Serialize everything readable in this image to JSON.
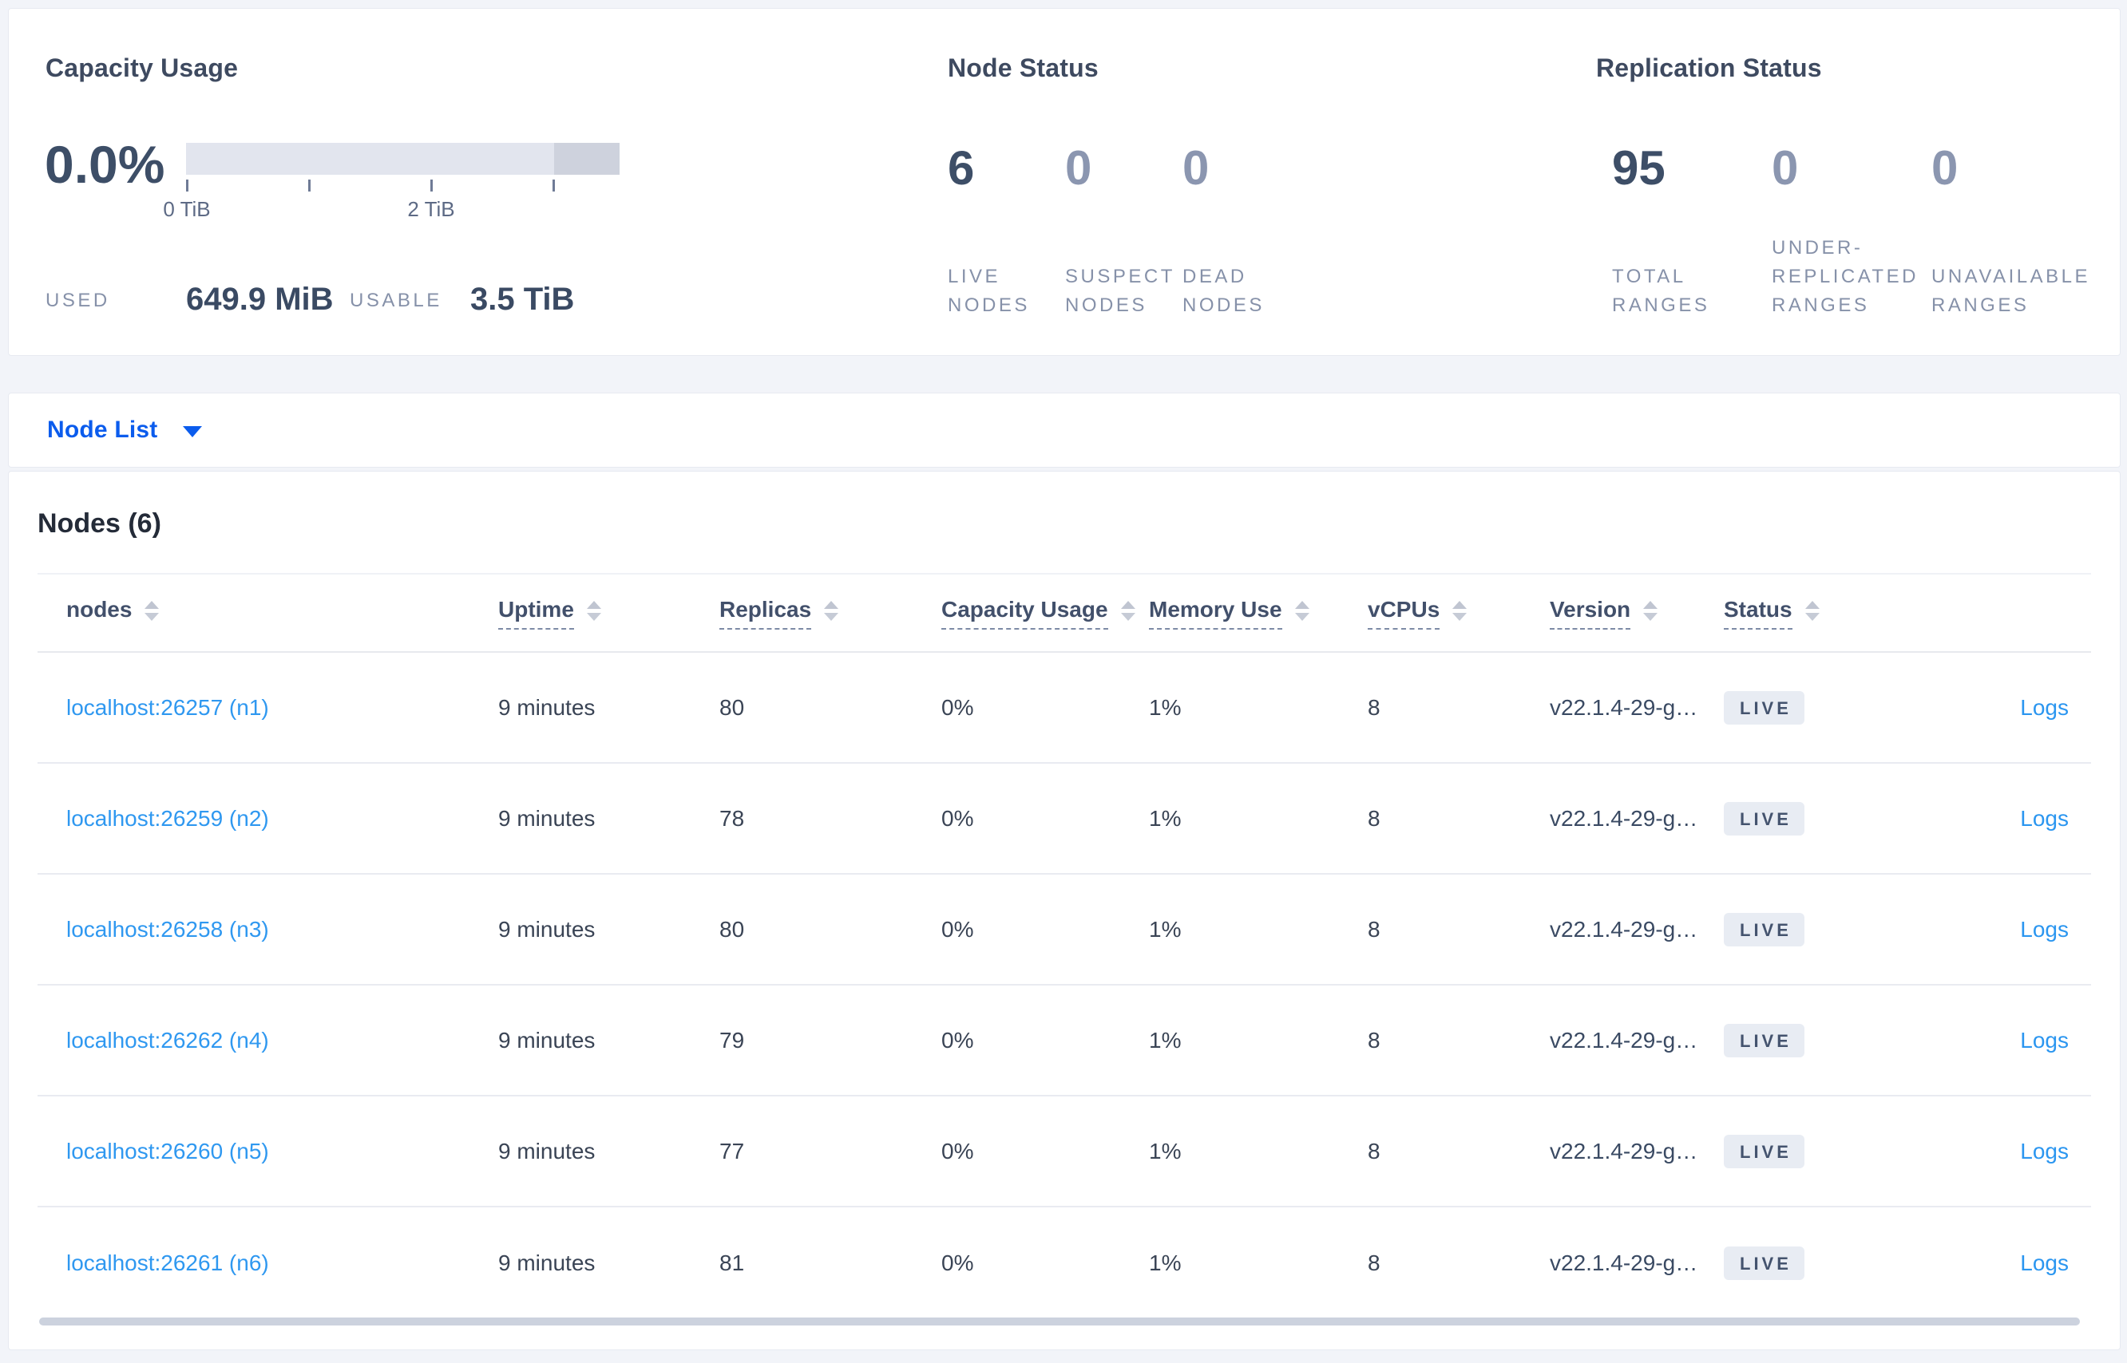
{
  "summary": {
    "capacity": {
      "title": "Capacity Usage",
      "percent": "0.0%",
      "tick_labels": [
        "0 TiB",
        "2 TiB"
      ],
      "used_label": "USED",
      "used_value": "649.9 MiB",
      "usable_label": "USABLE",
      "usable_value": "3.5 TiB",
      "bar_used_percent": 0,
      "bar_reserved_percent": 15.1
    },
    "node_status": {
      "title": "Node Status",
      "stats": [
        {
          "value": "6",
          "label": "LIVE NODES",
          "emphasized": true
        },
        {
          "value": "0",
          "label": "SUSPECT NODES",
          "emphasized": false
        },
        {
          "value": "0",
          "label": "DEAD NODES",
          "emphasized": false
        }
      ]
    },
    "replication_status": {
      "title": "Replication Status",
      "stats": [
        {
          "value": "95",
          "label": "TOTAL RANGES",
          "emphasized": true
        },
        {
          "value": "0",
          "label": "UNDER-REPLICATED RANGES",
          "emphasized": false
        },
        {
          "value": "0",
          "label": "UNAVAILABLE RANGES",
          "emphasized": false
        }
      ]
    }
  },
  "view_selector": {
    "label": "Node List"
  },
  "nodes_table": {
    "title": "Nodes (6)",
    "columns": [
      {
        "label": "nodes",
        "sortable": true,
        "dotted": false
      },
      {
        "label": "Uptime",
        "sortable": true,
        "dotted": true
      },
      {
        "label": "Replicas",
        "sortable": true,
        "dotted": true
      },
      {
        "label": "Capacity Usage",
        "sortable": true,
        "dotted": true
      },
      {
        "label": "Memory Use",
        "sortable": true,
        "dotted": true
      },
      {
        "label": "vCPUs",
        "sortable": true,
        "dotted": true
      },
      {
        "label": "Version",
        "sortable": true,
        "dotted": true
      },
      {
        "label": "Status",
        "sortable": true,
        "dotted": true
      },
      {
        "label": "",
        "sortable": false,
        "dotted": false
      }
    ],
    "rows": [
      {
        "address": "localhost:26257 (n1)",
        "uptime": "9 minutes",
        "replicas": "80",
        "capacity_usage": "0%",
        "memory_use": "1%",
        "vcpus": "8",
        "version": "v22.1.4-29-g…",
        "status": "LIVE",
        "logs_label": "Logs"
      },
      {
        "address": "localhost:26259 (n2)",
        "uptime": "9 minutes",
        "replicas": "78",
        "capacity_usage": "0%",
        "memory_use": "1%",
        "vcpus": "8",
        "version": "v22.1.4-29-g…",
        "status": "LIVE",
        "logs_label": "Logs"
      },
      {
        "address": "localhost:26258 (n3)",
        "uptime": "9 minutes",
        "replicas": "80",
        "capacity_usage": "0%",
        "memory_use": "1%",
        "vcpus": "8",
        "version": "v22.1.4-29-g…",
        "status": "LIVE",
        "logs_label": "Logs"
      },
      {
        "address": "localhost:26262 (n4)",
        "uptime": "9 minutes",
        "replicas": "79",
        "capacity_usage": "0%",
        "memory_use": "1%",
        "vcpus": "8",
        "version": "v22.1.4-29-g…",
        "status": "LIVE",
        "logs_label": "Logs"
      },
      {
        "address": "localhost:26260 (n5)",
        "uptime": "9 minutes",
        "replicas": "77",
        "capacity_usage": "0%",
        "memory_use": "1%",
        "vcpus": "8",
        "version": "v22.1.4-29-g…",
        "status": "LIVE",
        "logs_label": "Logs"
      },
      {
        "address": "localhost:26261 (n6)",
        "uptime": "9 minutes",
        "replicas": "81",
        "capacity_usage": "0%",
        "memory_use": "1%",
        "vcpus": "8",
        "version": "v22.1.4-29-g…",
        "status": "LIVE",
        "logs_label": "Logs"
      }
    ]
  },
  "colors": {
    "accent_blue": "#0b5ced",
    "row_link_blue": "#2f98f0",
    "badge_bg": "#e8ecf3",
    "badge_text": "#44536e"
  }
}
